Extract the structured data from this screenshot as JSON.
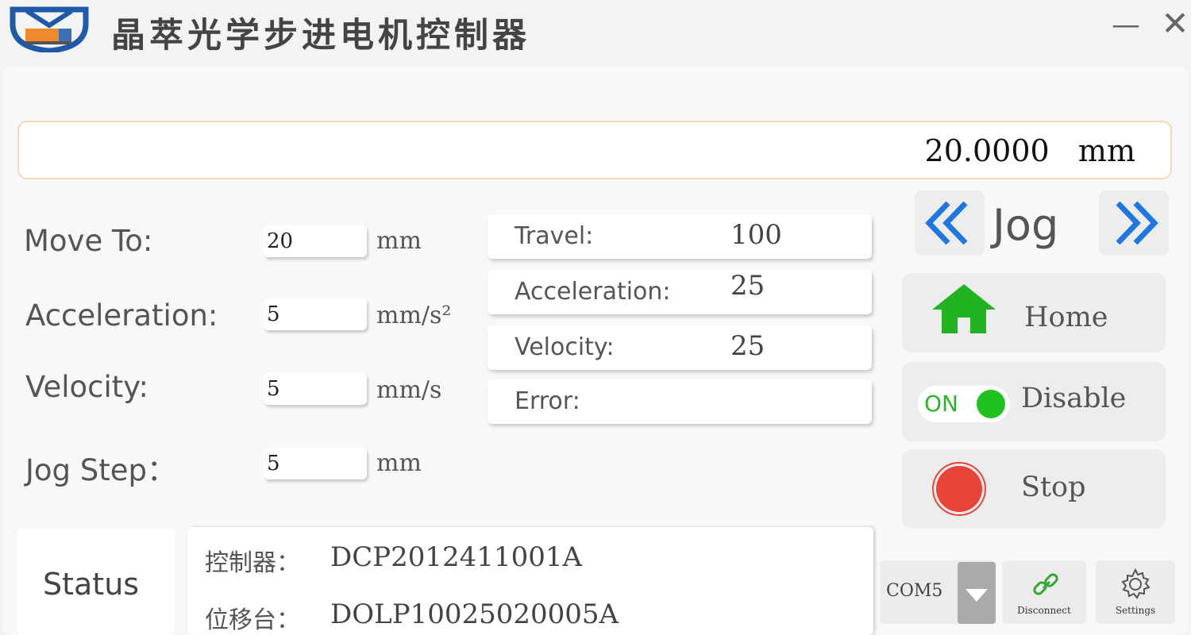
{
  "app": {
    "title": "晶萃光学步进电机控制器",
    "minimize_glyph": "—",
    "close_glyph": "✕"
  },
  "position_readout": {
    "value": "20.0000",
    "unit": "mm"
  },
  "parameters": {
    "move_to": {
      "label": "Move To:",
      "value": "20",
      "unit": "mm"
    },
    "acceleration": {
      "label": "Acceleration:",
      "value": "5",
      "unit": "mm/s²"
    },
    "velocity": {
      "label": "Velocity:",
      "value": "5",
      "unit": "mm/s"
    },
    "jog_step": {
      "label": "Jog Step：",
      "value": "5",
      "unit": "mm"
    }
  },
  "device_info": [
    {
      "key": "Travel:",
      "value": "100"
    },
    {
      "key": "Acceleration:",
      "value": "25"
    },
    {
      "key": "Velocity:",
      "value": "25"
    },
    {
      "key": "Error:",
      "value": ""
    }
  ],
  "controls": {
    "jog_label": "Jog",
    "home_label": "Home",
    "enable_toggle": "ON",
    "disable_label": "Disable",
    "stop_label": "Stop"
  },
  "status": {
    "label": "Status",
    "controller_key": "控制器：",
    "controller_value": "DCP2012411001A",
    "stage_key": "位移台：",
    "stage_value": "DOLP10025020005A"
  },
  "connection": {
    "port": "COM5",
    "disconnect_label": "Disconnect",
    "settings_label": "Settings"
  },
  "colors": {
    "accent_blue": "#1f78e0",
    "home_green": "#22b322",
    "toggle_green": "#1fc21f",
    "stop_red": "#e8443a",
    "readout_border": "#f7d7b4"
  },
  "icons": {
    "jog_left": "double-chevron-left-icon",
    "jog_right": "double-chevron-right-icon",
    "home": "house-icon",
    "stop": "stop-circle-icon",
    "dropdown": "triangle-down-icon",
    "disconnect": "link-icon",
    "settings": "gear-icon"
  }
}
